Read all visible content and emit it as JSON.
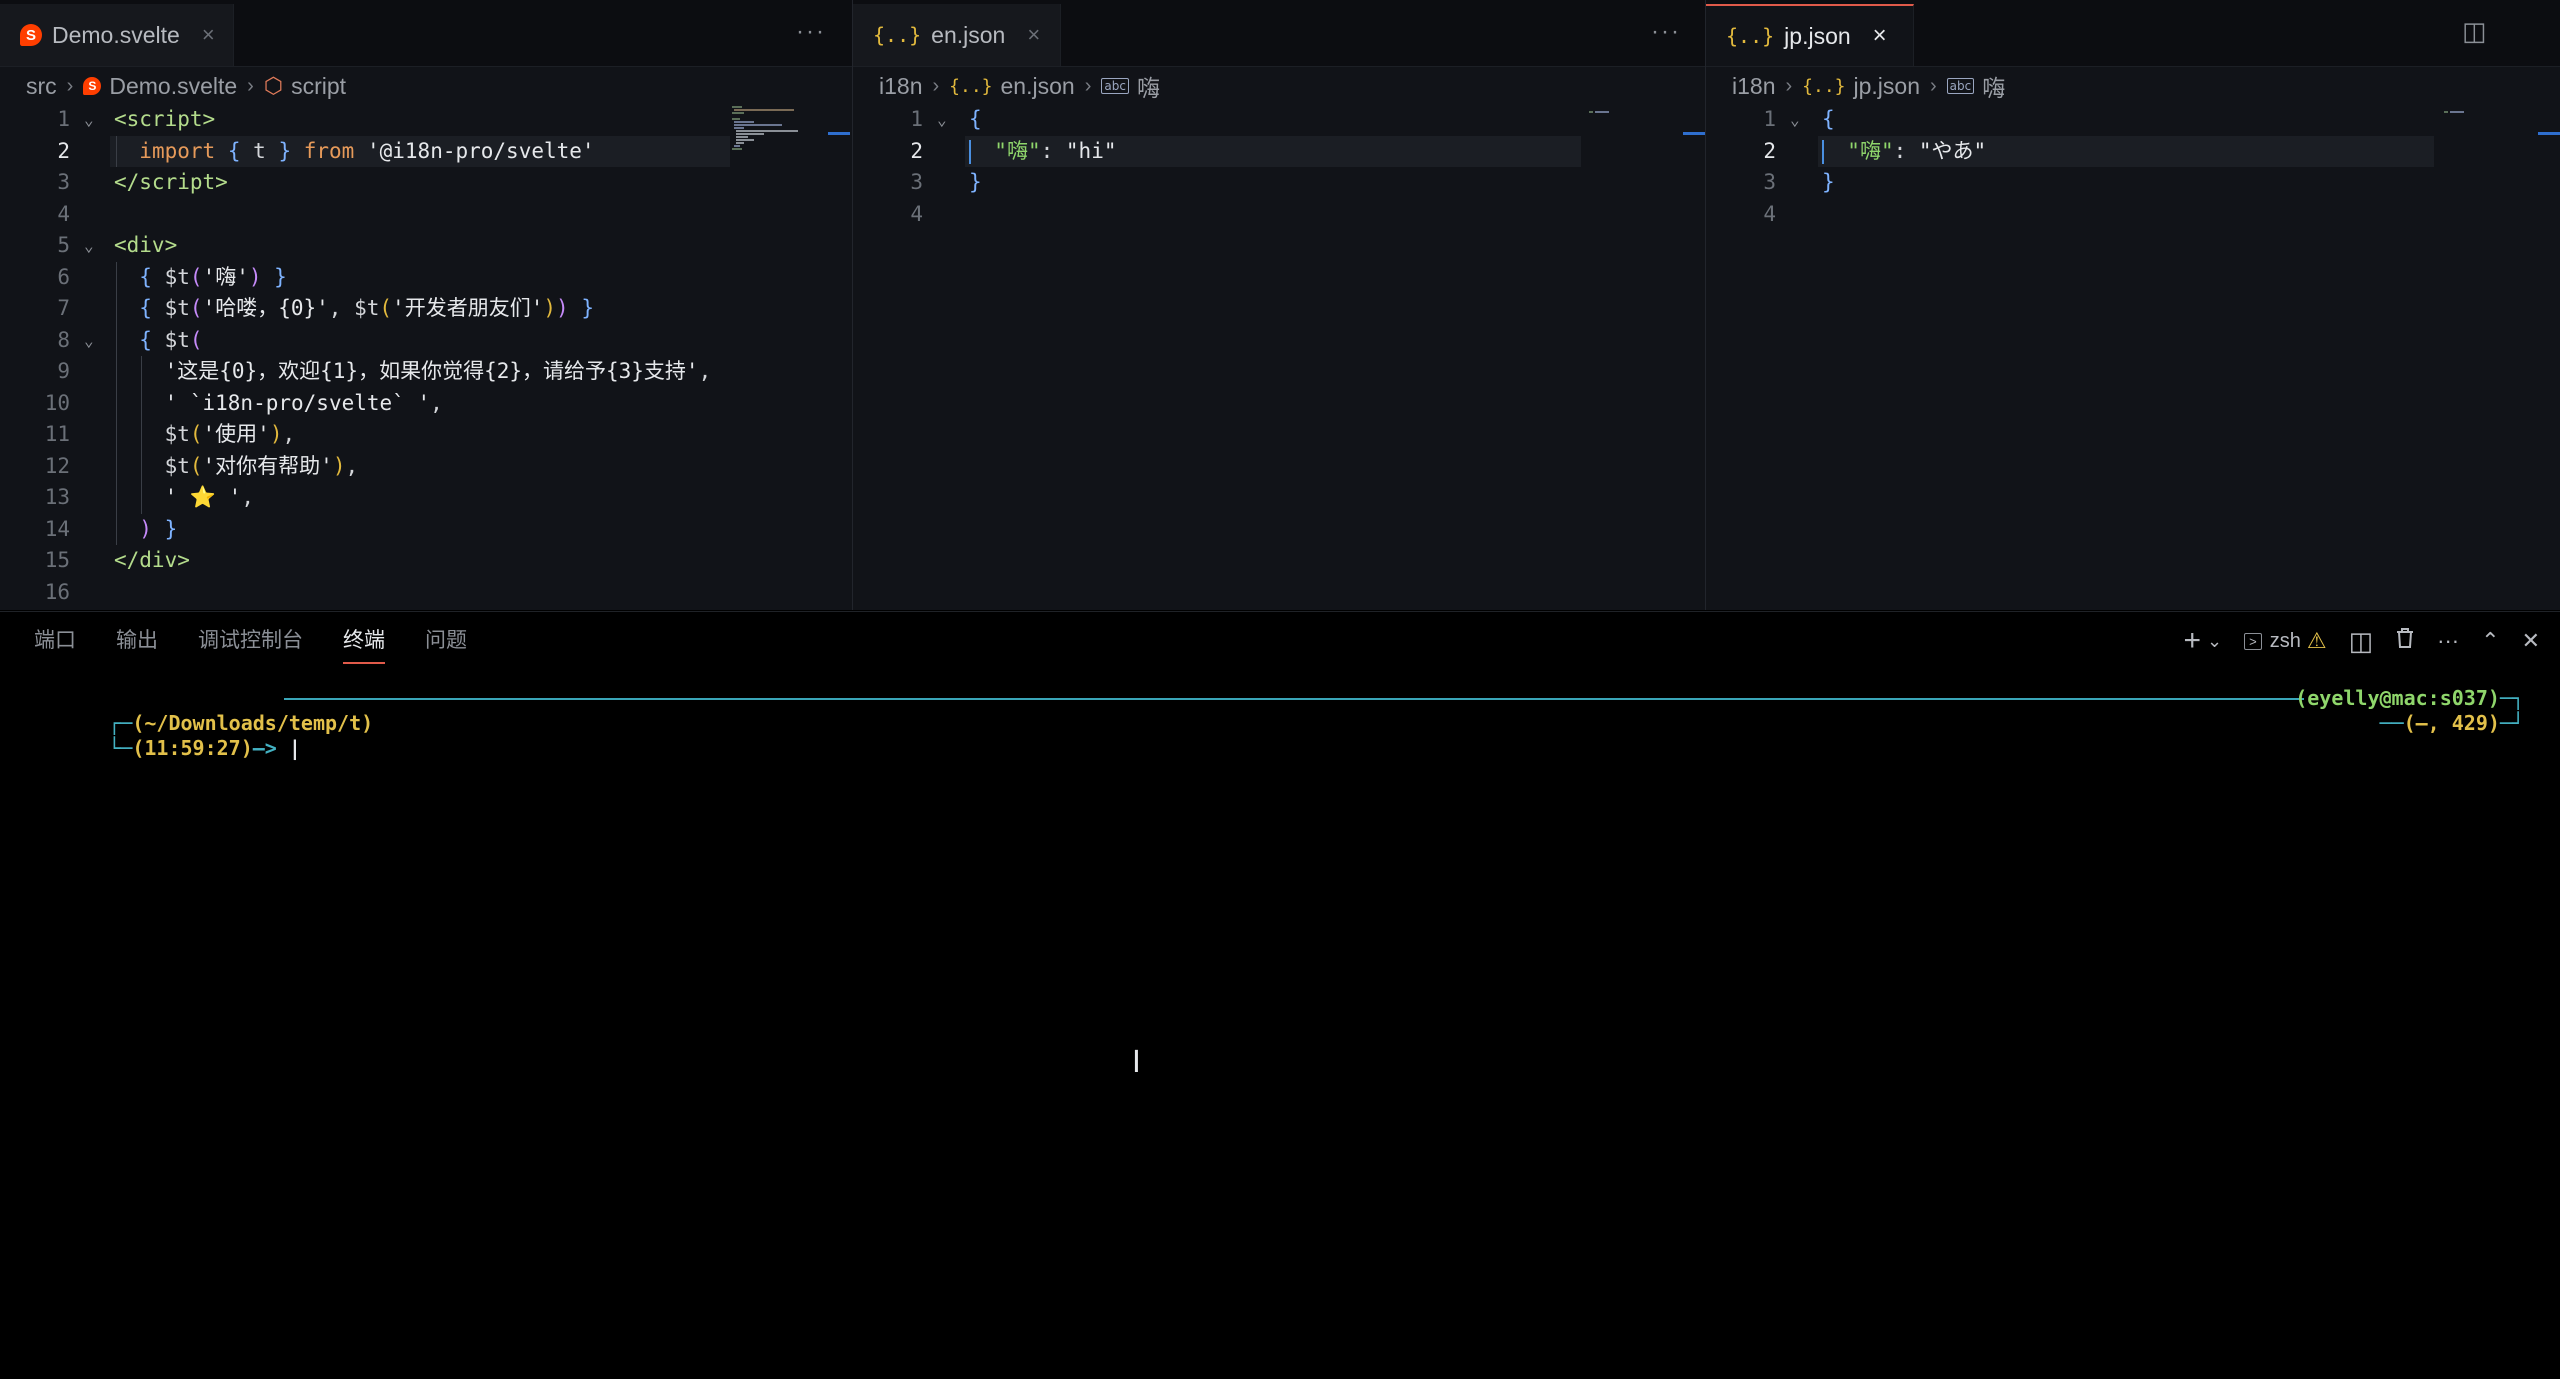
{
  "groups": [
    {
      "tab": {
        "label": "Demo.svelte",
        "close": "×"
      },
      "more": "···",
      "breadcrumb": [
        "src",
        "Demo.svelte",
        "script"
      ],
      "lines": [
        {
          "n": "1",
          "html": "<span class=\"tag\">&lt;script&gt;</span>"
        },
        {
          "n": "2",
          "html": "  <span class=\"kw\">import</span> <span class=\"brace1\">{</span> <span class=\"plain\">t</span> <span class=\"brace1\">}</span> <span class=\"kw\">from</span> <span class=\"str\">'@i18n-pro/svelte'</span>"
        },
        {
          "n": "3",
          "html": "<span class=\"tag\">&lt;/script&gt;</span>"
        },
        {
          "n": "4",
          "html": ""
        },
        {
          "n": "5",
          "html": "<span class=\"tag\">&lt;div&gt;</span>"
        },
        {
          "n": "6",
          "html": "  <span class=\"brace1\">{</span> <span class=\"plain\">$t</span><span class=\"brace2\">(</span><span class=\"str\">'嗨'</span><span class=\"brace2\">)</span> <span class=\"brace1\">}</span>"
        },
        {
          "n": "7",
          "html": "  <span class=\"brace1\">{</span> <span class=\"plain\">$t</span><span class=\"brace2\">(</span><span class=\"str\">'哈喽，{0}'</span><span class=\"plain\">,</span> <span class=\"plain\">$t</span><span class=\"brace3\">(</span><span class=\"str\">'开发者朋友们'</span><span class=\"brace3\">)</span><span class=\"brace2\">)</span> <span class=\"brace1\">}</span>"
        },
        {
          "n": "8",
          "html": "  <span class=\"brace1\">{</span> <span class=\"plain\">$t</span><span class=\"brace2\">(</span>"
        },
        {
          "n": "9",
          "html": "    <span class=\"str\">'这是{0}，欢迎{1}，如果你觉得{2}，请给予{3}支持'</span><span class=\"plain\">,</span>"
        },
        {
          "n": "10",
          "html": "    <span class=\"str\">' `i18n-pro/svelte` '</span><span class=\"plain\">,</span>"
        },
        {
          "n": "11",
          "html": "    <span class=\"plain\">$t</span><span class=\"brace3\">(</span><span class=\"str\">'使用'</span><span class=\"brace3\">)</span><span class=\"plain\">,</span>"
        },
        {
          "n": "12",
          "html": "    <span class=\"plain\">$t</span><span class=\"brace3\">(</span><span class=\"str\">'对你有帮助'</span><span class=\"brace3\">)</span><span class=\"plain\">,</span>"
        },
        {
          "n": "13",
          "html": "    <span class=\"str\">' ⭐️ '</span><span class=\"plain\">,</span>"
        },
        {
          "n": "14",
          "html": "  <span class=\"brace2\">)</span> <span class=\"brace1\">}</span>"
        },
        {
          "n": "15",
          "html": "<span class=\"tag\">&lt;/div&gt;</span>"
        },
        {
          "n": "16",
          "html": ""
        }
      ]
    },
    {
      "tab": {
        "label": "en.json",
        "close": "×"
      },
      "more": "···",
      "breadcrumb": [
        "i18n",
        "en.json",
        "嗨"
      ],
      "lines": [
        {
          "n": "1",
          "html": "<span class=\"brace1\">{</span>"
        },
        {
          "n": "2",
          "html": "  <span class=\"key\">\"嗨\"</span><span class=\"plain\">:</span> <span class=\"str\">\"hi\"</span>"
        },
        {
          "n": "3",
          "html": "<span class=\"brace1\">}</span>"
        },
        {
          "n": "4",
          "html": ""
        }
      ]
    },
    {
      "tab": {
        "label": "jp.json",
        "close": "×"
      },
      "breadcrumb": [
        "i18n",
        "jp.json",
        "嗨"
      ],
      "lines": [
        {
          "n": "1",
          "html": "<span class=\"brace1\">{</span>"
        },
        {
          "n": "2",
          "html": "  <span class=\"key\">\"嗨\"</span><span class=\"plain\">:</span> <span class=\"str\">\"やあ\"</span>"
        },
        {
          "n": "3",
          "html": "<span class=\"brace1\">}</span>"
        },
        {
          "n": "4",
          "html": ""
        }
      ]
    }
  ],
  "panel": {
    "tabs": [
      "端口",
      "输出",
      "调试控制台",
      "终端",
      "问题"
    ],
    "active_tab": "终端",
    "actions": {
      "add": "+",
      "dropdown": "⌄",
      "shell": "zsh",
      "warning": "⚠",
      "split": "◫",
      "trash": "🗑",
      "more": "···",
      "maximize": "⌃",
      "close": "✕"
    }
  },
  "terminal": {
    "path": "(~/Downloads/temp/t)",
    "time": "(11:59:27)",
    "arrow": "—>",
    "user_host": "(eyelly@mac:s037)",
    "status": "(—, 429)"
  },
  "colors": {
    "accent": "#e05a4a",
    "teal": "#43b1c2",
    "yellow": "#e2c04a",
    "green": "#8fd66b"
  }
}
